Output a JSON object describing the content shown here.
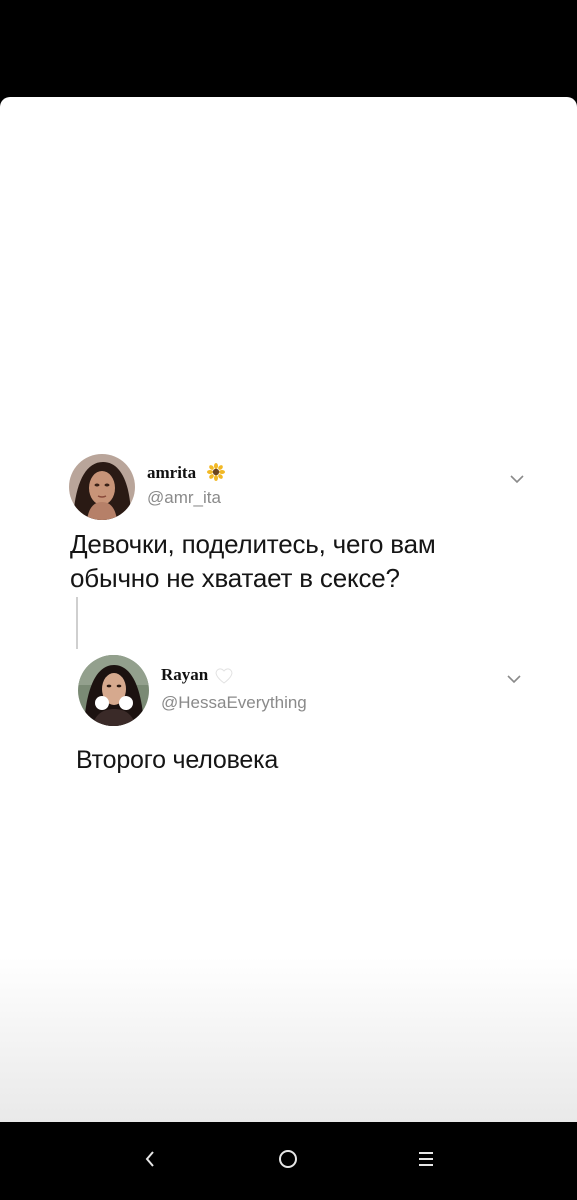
{
  "tweet1": {
    "name": "amrita",
    "name_emoji": "sunflower-icon",
    "handle": "@amr_ita",
    "text_line1": "Девочки, поделитесь, чего вам",
    "text_line2": "обычно не хватает в сексе?"
  },
  "tweet2": {
    "name": "Rayan",
    "name_emoji": "white-heart-icon",
    "handle": "@HessaEverything",
    "text": "Второго человека"
  },
  "navigation": {
    "back_icon": "back-chevron-icon",
    "home_icon": "home-circle-icon",
    "menu_icon": "menu-lines-icon"
  },
  "colors": {
    "background": "#000000",
    "card": "#ffffff",
    "text": "#151515",
    "handle": "#8a8a8a"
  }
}
